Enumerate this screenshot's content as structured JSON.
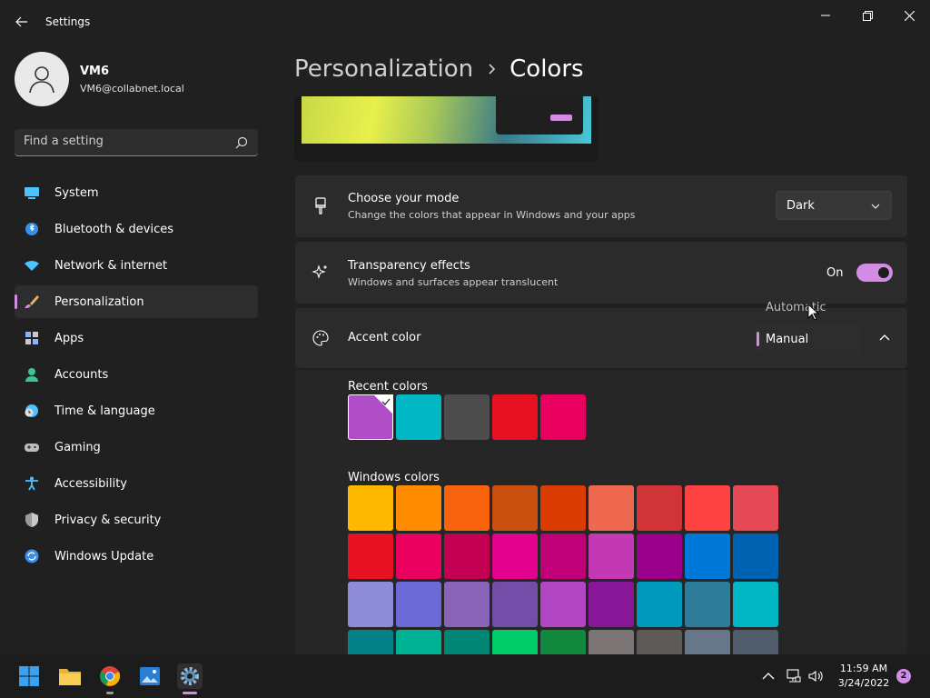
{
  "window": {
    "title": "Settings"
  },
  "profile": {
    "name": "VM6",
    "email": "VM6@collabnet.local"
  },
  "search": {
    "placeholder": "Find a setting"
  },
  "sidebar": {
    "items": [
      {
        "label": "System",
        "icon": "monitor-icon",
        "active": false
      },
      {
        "label": "Bluetooth & devices",
        "icon": "bluetooth-icon",
        "active": false
      },
      {
        "label": "Network & internet",
        "icon": "wifi-icon",
        "active": false
      },
      {
        "label": "Personalization",
        "icon": "brush-icon",
        "active": true
      },
      {
        "label": "Apps",
        "icon": "apps-icon",
        "active": false
      },
      {
        "label": "Accounts",
        "icon": "person-icon",
        "active": false
      },
      {
        "label": "Time & language",
        "icon": "clock-globe-icon",
        "active": false
      },
      {
        "label": "Gaming",
        "icon": "gamepad-icon",
        "active": false
      },
      {
        "label": "Accessibility",
        "icon": "accessibility-icon",
        "active": false
      },
      {
        "label": "Privacy & security",
        "icon": "shield-icon",
        "active": false
      },
      {
        "label": "Windows Update",
        "icon": "update-icon",
        "active": false
      }
    ]
  },
  "breadcrumb": {
    "parent": "Personalization",
    "current": "Colors"
  },
  "mode": {
    "title": "Choose your mode",
    "subtitle": "Change the colors that appear in Windows and your apps",
    "value": "Dark"
  },
  "transparency": {
    "title": "Transparency effects",
    "subtitle": "Windows and surfaces appear translucent",
    "state_label": "On",
    "enabled": true
  },
  "accent": {
    "title": "Accent color",
    "options": [
      "Automatic",
      "Manual"
    ],
    "selected": "Manual"
  },
  "recent_colors": {
    "label": "Recent colors",
    "colors": [
      "#b04ec8",
      "#00b7c3",
      "#4c4c4c",
      "#e81123",
      "#ea005e"
    ],
    "selected_index": 0
  },
  "windows_colors": {
    "label": "Windows colors",
    "rows": [
      [
        "#ffb900",
        "#ff8c00",
        "#f7630c",
        "#ca5010",
        "#da3b01",
        "#ef6950",
        "#d13438",
        "#ff4343",
        "#e74856"
      ],
      [
        "#e81123",
        "#ea005e",
        "#c30052",
        "#e3008c",
        "#bf0077",
        "#c239b3",
        "#9a0089",
        "#0078d7",
        "#0063b1"
      ],
      [
        "#8e8cd8",
        "#6b69d6",
        "#8764b8",
        "#744da9",
        "#b146c2",
        "#881798",
        "#0099bc",
        "#2d7d9a",
        "#00b7c3"
      ],
      [
        "#038387",
        "#00b294",
        "#018574",
        "#00cc6a",
        "#10893e",
        "#7a7574",
        "#5d5a58",
        "#68768a",
        "#515c6b"
      ]
    ]
  },
  "colors": {
    "accent": "#d38ce3"
  },
  "taskbar": {
    "time": "11:59 AM",
    "date": "3/24/2022",
    "notifications": "2"
  }
}
